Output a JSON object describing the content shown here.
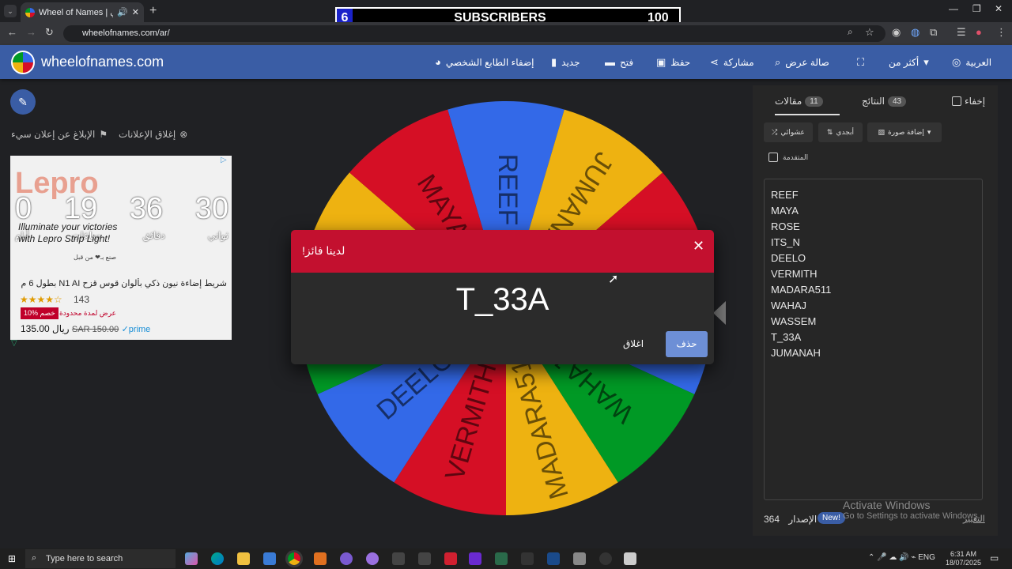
{
  "browser": {
    "tab_title": "Wheel of Names | العشوائي...",
    "url": "wheelofnames.com/ar/"
  },
  "overlay": {
    "left_number": "6",
    "label": "SUBSCRIBERS",
    "right_number": "100"
  },
  "header": {
    "brand": "wheelofnames.com",
    "menu": {
      "customize": "إضفاء الطابع الشخصي",
      "new": "جديد",
      "open": "فتح",
      "save": "حفظ",
      "share": "مشاركة",
      "gallery": "صالة عرض",
      "more": "أكثر من",
      "language": "العربية"
    }
  },
  "ads": {
    "close_ads": "إغلاق الإعلانات",
    "report_ad": "الإبلاغ عن إعلان سيء",
    "brand": "Lepro",
    "countdown": [
      "0",
      "19",
      "36",
      "30"
    ],
    "units": [
      "أيام",
      "ساعات",
      "دقائق",
      "ثواني"
    ],
    "tagline_1": "Illuminate your victories",
    "tagline_2": "with Lepro Strip Light!",
    "made_by": "صنع بـ❤ من قبل",
    "product_title": "شريط إضاءة نيون ذكي بألوان قوس قزح N1 AI بطول 6 م من...",
    "stars": "★★★★☆",
    "rating_count": "143",
    "discount": "10% خصم",
    "offer": "عرض لمدة محدودة",
    "price": "135.00 ريال",
    "old_price": "SAR 150.00",
    "prime": "✓prime"
  },
  "wheel": {
    "segments": [
      "REEF",
      "JUMANAH",
      "T_33A",
      "WASSEM",
      "WAHAJ",
      "MADARA511",
      "VERMITH",
      "DEELO",
      "ITS_N",
      "ROSE",
      "MAYA"
    ],
    "colors": [
      "#3369e8",
      "#eeb211",
      "#d50f25",
      "#3369e8",
      "#009925",
      "#eeb211",
      "#d50f25",
      "#3369e8",
      "#009925",
      "#eeb211",
      "#d50f25"
    ]
  },
  "modal": {
    "title": "لدينا فائز!",
    "winner": "T_33A",
    "close": "اغلاق",
    "delete": "حذف"
  },
  "panel": {
    "hide": "إخفاء",
    "results_label": "النتائج",
    "results_count": "43",
    "entries_label": "مقالات",
    "entries_count": "11",
    "shuffle": "عشوائي",
    "sort": "أبجدي",
    "add_image": "إضافة صورة",
    "advanced": "المتقدمة",
    "entries": [
      "REEF",
      "MAYA",
      "ROSE",
      "ITS_N",
      "DEELO",
      "VERMITH",
      "MADARA511",
      "WAHAJ",
      "WASSEM",
      "T_33A",
      "JUMANAH"
    ],
    "version_label": "الإصدار",
    "version_number": "364",
    "new_badge": "New!",
    "changes": "التغيير"
  },
  "watermark": {
    "line1": "Activate Windows",
    "line2": "Go to Settings to activate Windows."
  },
  "taskbar": {
    "search_placeholder": "Type here to search",
    "lang": "ENG",
    "time": "6:31 AM",
    "date": "18/07/2025"
  }
}
